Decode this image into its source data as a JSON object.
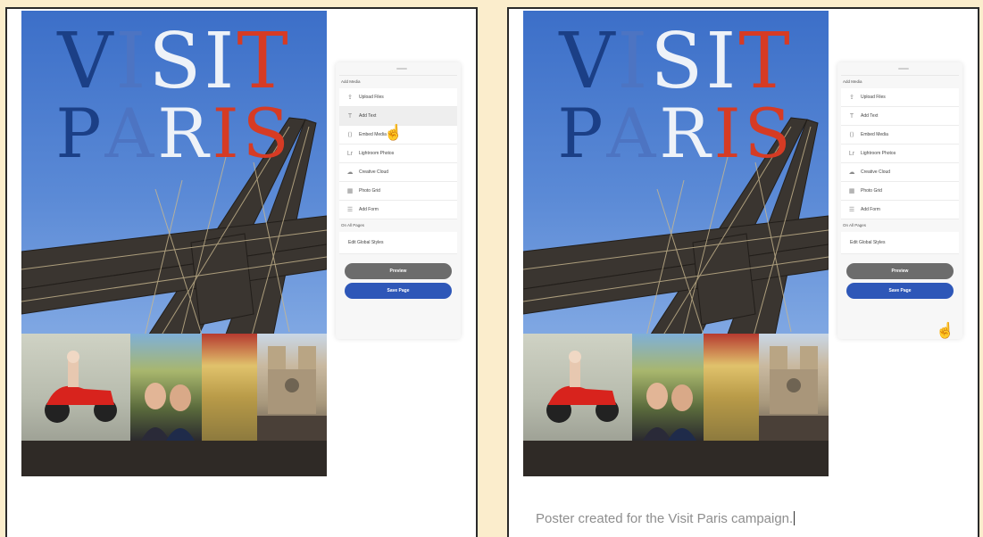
{
  "colors": {
    "background": "#fbedcc",
    "save_button": "#2e57b8",
    "preview_button": "#6c6c6c",
    "title_red": "#d63b24",
    "title_blue": "#1b3f86"
  },
  "poster": {
    "title_line1": [
      "V",
      "I",
      "S",
      "I",
      "T"
    ],
    "title_line2": [
      "P",
      "A",
      "R",
      "I",
      "S"
    ],
    "collage": [
      "scooter-photo",
      "friends-photo",
      "statue-photo",
      "notre-dame-photo"
    ]
  },
  "left": {
    "panel": {
      "add_media_label": "Add Media",
      "items": [
        {
          "label": "Upload Files",
          "icon": "upload-icon",
          "glyph": "⇪"
        },
        {
          "label": "Add Text",
          "icon": "text-icon",
          "glyph": "T"
        },
        {
          "label": "Embed Media",
          "icon": "embed-icon",
          "glyph": "⟨⟩"
        },
        {
          "label": "Lightroom Photos",
          "icon": "lightroom-icon",
          "glyph": "Lr"
        },
        {
          "label": "Creative Cloud",
          "icon": "creative-cloud-icon",
          "glyph": "☁"
        },
        {
          "label": "Photo Grid",
          "icon": "photo-grid-icon",
          "glyph": "▦"
        },
        {
          "label": "Add Form",
          "icon": "form-icon",
          "glyph": "☰"
        }
      ],
      "all_pages_label": "On All Pages",
      "global_styles_label": "Edit Global Styles",
      "preview_label": "Preview",
      "save_label": "Save Page"
    },
    "cursor_glyph": "☝"
  },
  "right": {
    "panel": {
      "add_media_label": "Add Media",
      "items": [
        {
          "label": "Upload Files",
          "icon": "upload-icon",
          "glyph": "⇪"
        },
        {
          "label": "Add Text",
          "icon": "text-icon",
          "glyph": "T"
        },
        {
          "label": "Embed Media",
          "icon": "embed-icon",
          "glyph": "⟨⟩"
        },
        {
          "label": "Lightroom Photos",
          "icon": "lightroom-icon",
          "glyph": "Lr"
        },
        {
          "label": "Creative Cloud",
          "icon": "creative-cloud-icon",
          "glyph": "☁"
        },
        {
          "label": "Photo Grid",
          "icon": "photo-grid-icon",
          "glyph": "▦"
        },
        {
          "label": "Add Form",
          "icon": "form-icon",
          "glyph": "☰"
        }
      ],
      "all_pages_label": "On All Pages",
      "global_styles_label": "Edit Global Styles",
      "preview_label": "Preview",
      "save_label": "Save Page"
    },
    "cursor_glyph": "☝",
    "caption": "Poster created for the Visit Paris campaign."
  }
}
